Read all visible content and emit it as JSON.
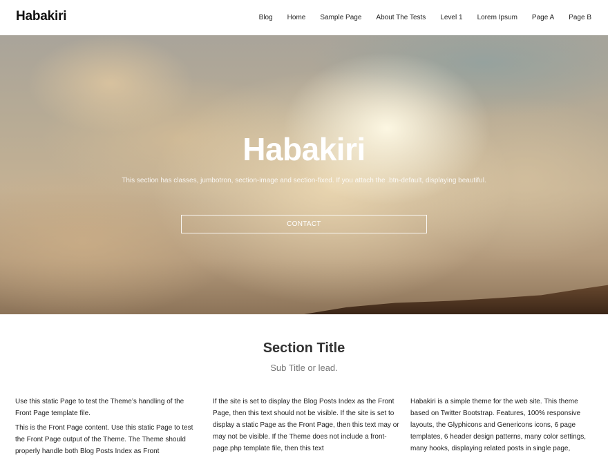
{
  "header": {
    "brand": "Habakiri",
    "nav": [
      "Blog",
      "Home",
      "Sample Page",
      "About The Tests",
      "Level 1",
      "Lorem Ipsum",
      "Page A",
      "Page B"
    ]
  },
  "hero": {
    "title": "Habakiri",
    "text": "This section has classes, jumbotron, section-image and section-fixed. If you attach the .btn-default, displaying beautiful.",
    "button": "CONTACT"
  },
  "section": {
    "title": "Section Title",
    "subtitle": "Sub Title or lead.",
    "col1": {
      "p1": "Use this static Page to test the Theme’s handling of the Front Page template file.",
      "p2": "This is the Front Page content. Use this static Page to test the Front Page output of the Theme. The Theme should properly handle both Blog Posts Index as Front"
    },
    "col2": {
      "p1": "If the site is set to display the Blog Posts Index as the Front Page, then this text should not be visible. If the site is set to display a static Page as the Front Page, then this text may or may not be visible. If the Theme does not include a front-page.php template file, then this text"
    },
    "col3": {
      "p1": "Habakiri is a simple theme for the web site. This theme based on Twitter Bootstrap. Features, 100% responsive layouts, the Glyphicons and Genericons icons, 6 page templates, 6 header design patterns, many color settings, many hooks, displaying related posts in single page,"
    }
  }
}
